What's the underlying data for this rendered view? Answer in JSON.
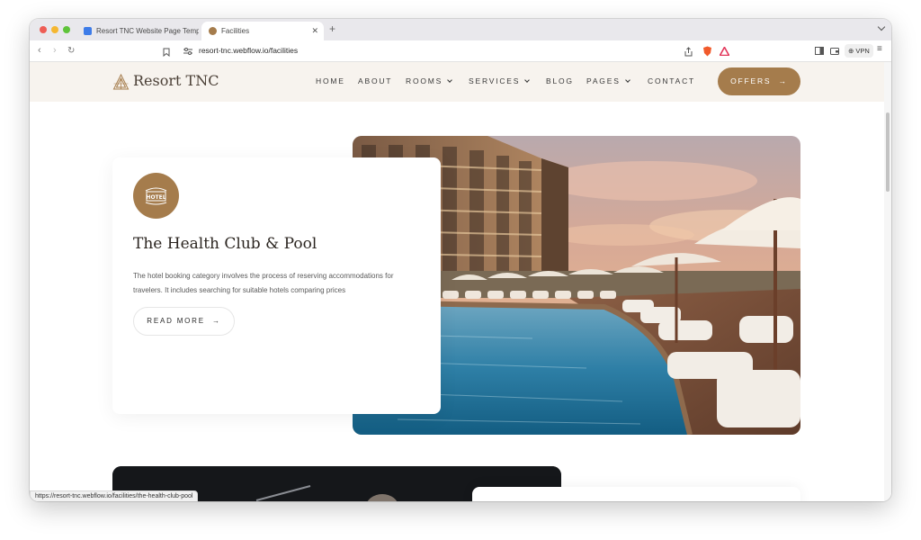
{
  "browser": {
    "tabs": [
      {
        "label": "Resort TNC Website Page Templ…",
        "active": false
      },
      {
        "label": "Facilities",
        "active": true
      }
    ],
    "new_tab": "+",
    "url": "resort-tnc.webflow.io/facilities",
    "vpn_label": "VPN",
    "status_url": "https://resort-tnc.webflow.io/facilities/the-health-club-pool"
  },
  "site": {
    "logo_text": "Resort TNC",
    "nav": [
      {
        "label": "HOME",
        "dropdown": false
      },
      {
        "label": "ABOUT",
        "dropdown": false
      },
      {
        "label": "ROOMS",
        "dropdown": true
      },
      {
        "label": "SERVICES",
        "dropdown": true
      },
      {
        "label": "BLOG",
        "dropdown": false
      },
      {
        "label": "PAGES",
        "dropdown": true
      },
      {
        "label": "CONTACT",
        "dropdown": false
      }
    ],
    "offers_label": "OFFERS",
    "accent_color": "#a57c4c"
  },
  "facility": {
    "badge_text": "HOTEL",
    "title": "The Health Club & Pool",
    "description": "The hotel booking category involves the process of reserving accommodations for travelers. It includes searching for suitable hotels comparing prices",
    "read_more_label": "READ MORE"
  }
}
